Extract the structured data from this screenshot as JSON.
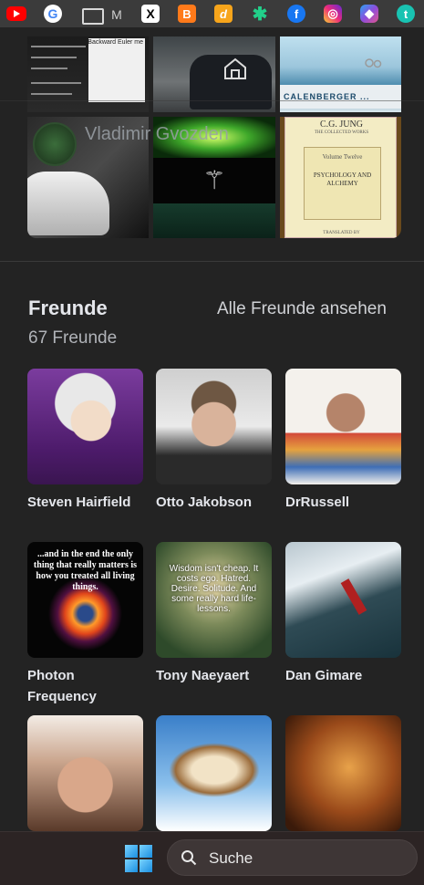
{
  "bookmarks": {
    "items": [
      {
        "name": "youtube-icon"
      },
      {
        "name": "google-icon",
        "glyph": "G"
      },
      {
        "name": "folder-icon"
      },
      {
        "name": "gmail-icon",
        "glyph": "M"
      },
      {
        "name": "x-icon",
        "glyph": "X"
      },
      {
        "name": "blogger-icon",
        "glyph": "B"
      },
      {
        "name": "deviantart-icon",
        "glyph": "d"
      },
      {
        "name": "asterisk-icon",
        "glyph": "✱"
      },
      {
        "name": "facebook-icon",
        "glyph": "f"
      },
      {
        "name": "instagram-icon",
        "glyph": "◎"
      },
      {
        "name": "copilot-icon",
        "glyph": "◆"
      },
      {
        "name": "tumblr-icon",
        "glyph": "t"
      }
    ]
  },
  "profile": {
    "overlay_name": "Vladimir Gvozden",
    "photos": {
      "code_panel_title": "Backward Euler me",
      "sign_text": "CALENBERGER ...",
      "book": {
        "author": "C.G. JUNG",
        "series": "THE COLLECTED WORKS",
        "volume": "Volume Twelve",
        "title": "PSYCHOLOGY AND ALCHEMY",
        "footer": "TRANSLATED BY"
      }
    }
  },
  "friends": {
    "title": "Freunde",
    "count": "67 Freunde",
    "see_all": "Alle Freunde ansehen",
    "items": [
      {
        "name": "Steven Hairfield"
      },
      {
        "name": "Otto Jakobson"
      },
      {
        "name": "DrRussell"
      },
      {
        "name": "Photon Frequency",
        "image_text": "...and in the end the only thing that really matters is how you treated all living things."
      },
      {
        "name": "Tony Naeyaert",
        "image_text": "Wisdom isn't cheap. It costs ego. Hatred. Desire. Solitude. And some really hard life-lessons."
      },
      {
        "name": "Dan Gimare"
      },
      {
        "name": ""
      },
      {
        "name": ""
      },
      {
        "name": ""
      }
    ]
  },
  "taskbar": {
    "search_label": "Suche"
  },
  "colors": {
    "background": "#232323",
    "bookmarks_bar": "#3b3b3b",
    "taskbar": "#2c2424",
    "text_primary": "#e4e6eb",
    "text_secondary": "#b0b3b8"
  }
}
